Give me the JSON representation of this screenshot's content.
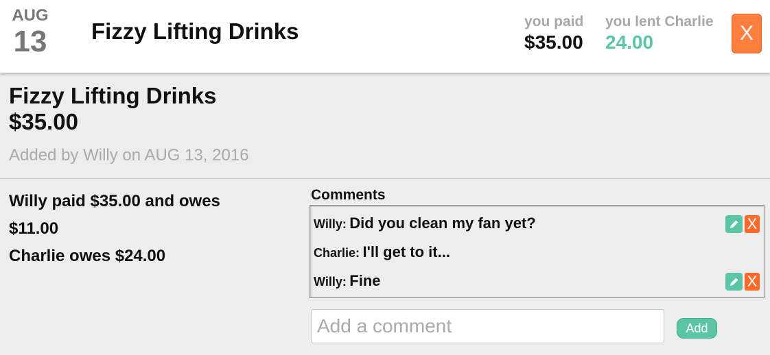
{
  "header": {
    "date_month": "AUG",
    "date_day": "13",
    "title": "Fizzy Lifting Drinks",
    "paid_label": "you paid",
    "paid_value": "$35.00",
    "lent_label": "you lent Charlie",
    "lent_value": "24.00",
    "close_label": "X"
  },
  "detail": {
    "title": "Fizzy Lifting Drinks",
    "amount": "$35.00",
    "meta": "Added by Willy on AUG 13, 2016"
  },
  "split": {
    "lines": [
      "Willy paid $35.00 and owes",
      "$11.00",
      "Charlie owes $24.00"
    ]
  },
  "comments": {
    "heading": "Comments",
    "items": [
      {
        "author": "Willy:",
        "text": "Did you clean my fan yet?",
        "editable": true
      },
      {
        "author": "Charlie:",
        "text": "I'll get to it...",
        "editable": false
      },
      {
        "author": "Willy:",
        "text": "Fine",
        "editable": true
      }
    ],
    "delete_label": "X",
    "input_placeholder": "Add a comment",
    "add_label": "Add"
  },
  "colors": {
    "accent_green": "#5bc5a7",
    "accent_orange": "#ff7f3f"
  },
  "icons": {
    "edit": "pencil-icon"
  }
}
